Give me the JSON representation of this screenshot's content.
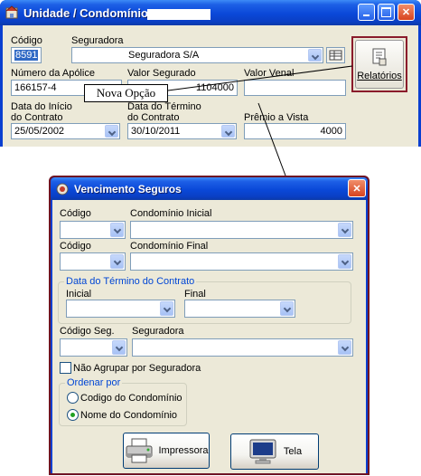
{
  "main_window": {
    "title": "Unidade / Condomínio",
    "fields": {
      "codigo_label": "Código",
      "codigo_value": "8591",
      "seguradora_label": "Seguradora",
      "seguradora_value": "Seguradora S/A",
      "apolice_label": "Número da Apólice",
      "apolice_value": "166157-4",
      "valor_segurado_label": "Valor Segurado",
      "valor_segurado_value": "1104000",
      "valor_venal_label": "Valor Venal",
      "valor_venal_value": "",
      "data_inicio_label_1": "Data do Início",
      "data_inicio_label_2": "do Contrato",
      "data_inicio_value": "25/05/2002",
      "data_termino_label_1": "Data do Término",
      "data_termino_label_2": "do Contrato",
      "data_termino_value": "30/10/2011",
      "premio_label": "Prêmio a Vista",
      "premio_value": "4000"
    },
    "relatorios_label": "Relatórios"
  },
  "callout": {
    "text": "Nova Opção"
  },
  "dialog": {
    "title": "Vencimento Seguros",
    "codigo_inicial_label": "Código",
    "condominio_inicial_label": "Condomínio Inicial",
    "codigo_final_label": "Código",
    "condominio_final_label": "Condomínio Final",
    "data_group_title": "Data do Término do Contrato",
    "inicial_label": "Inicial",
    "final_label": "Final",
    "codigo_seg_label": "Código Seg.",
    "seguradora_label": "Seguradora",
    "nao_agrupar_label": "Não Agrupar por Seguradora",
    "ordenar_title": "Ordenar por",
    "order_options": [
      "Codigo do Condomínio",
      "Nome do Condomínio"
    ],
    "order_selected": "Nome do Condomínio",
    "impressora_label": "Impressora",
    "tela_label": "Tela"
  }
}
